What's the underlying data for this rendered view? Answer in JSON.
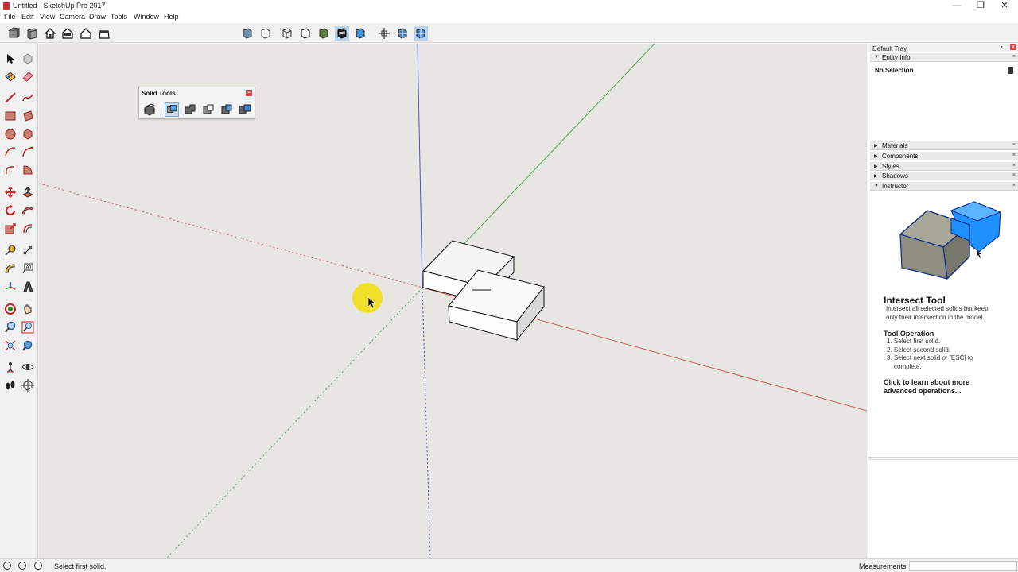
{
  "window": {
    "title": "Untitled - SketchUp Pro 2017",
    "minimize": "—",
    "maximize": "❐",
    "close": "✕"
  },
  "menu": [
    "File",
    "Edit",
    "View",
    "Camera",
    "Draw",
    "Tools",
    "Window",
    "Help"
  ],
  "solid_tools": {
    "title": "Solid Tools",
    "close": "×"
  },
  "tray": {
    "title": "Default Tray",
    "pin": "📌",
    "close": "×",
    "entity_info": {
      "label": "Entity Info",
      "value": "No Selection"
    },
    "panels": [
      "Materials",
      "Components",
      "Styles",
      "Shadows",
      "Instructor"
    ],
    "instructor": {
      "title": "Intersect Tool",
      "description_1": "Intersect all selected solids but keep",
      "description_2": "only their intersection in the model.",
      "operation_title": "Tool Operation",
      "step_1": "1. Select first solid.",
      "step_2": "2. Select second solid.",
      "step_3a": "3. Select next solid or [ESC] to",
      "step_3b": "complete.",
      "link_1": "Click to learn about more",
      "link_2": "advanced operations..."
    }
  },
  "status": {
    "text": "Select first solid.",
    "measurements_label": "Measurements",
    "measurements_value": ""
  },
  "colors": {
    "x_axis": "#c9514b",
    "y_axis": "#3f9f3f",
    "z_axis": "#3b45c4",
    "cursor_highlight": "#f1de14",
    "instructor_accent": "#1e90ff"
  }
}
